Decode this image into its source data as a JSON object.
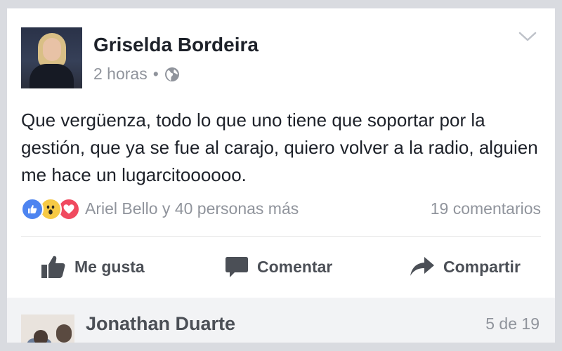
{
  "post": {
    "author": "Griselda Bordeira",
    "time": "2 horas",
    "separator": "•",
    "audience_icon": "globe-icon",
    "text": "Que vergüenza, todo lo que uno tiene que soportar por la gestión, que ya se fue al carajo, quiero volver a la radio, alguien me hace un lugarcitoooooo."
  },
  "reactions": {
    "icons": [
      "like-icon",
      "wow-icon",
      "love-icon"
    ],
    "summary": "Ariel Bello y 40 personas más",
    "comments": "19 comentarios"
  },
  "actions": {
    "like": "Me gusta",
    "comment": "Comentar",
    "share": "Compartir"
  },
  "comment_preview": {
    "name": "Jonathan Duarte",
    "pager": "5 de 19"
  },
  "colors": {
    "like_blue": "#4d84f0",
    "wow_yellow": "#f6c945",
    "love_red": "#f04a5f",
    "text_primary": "#1d2129",
    "text_secondary": "#90949c"
  }
}
